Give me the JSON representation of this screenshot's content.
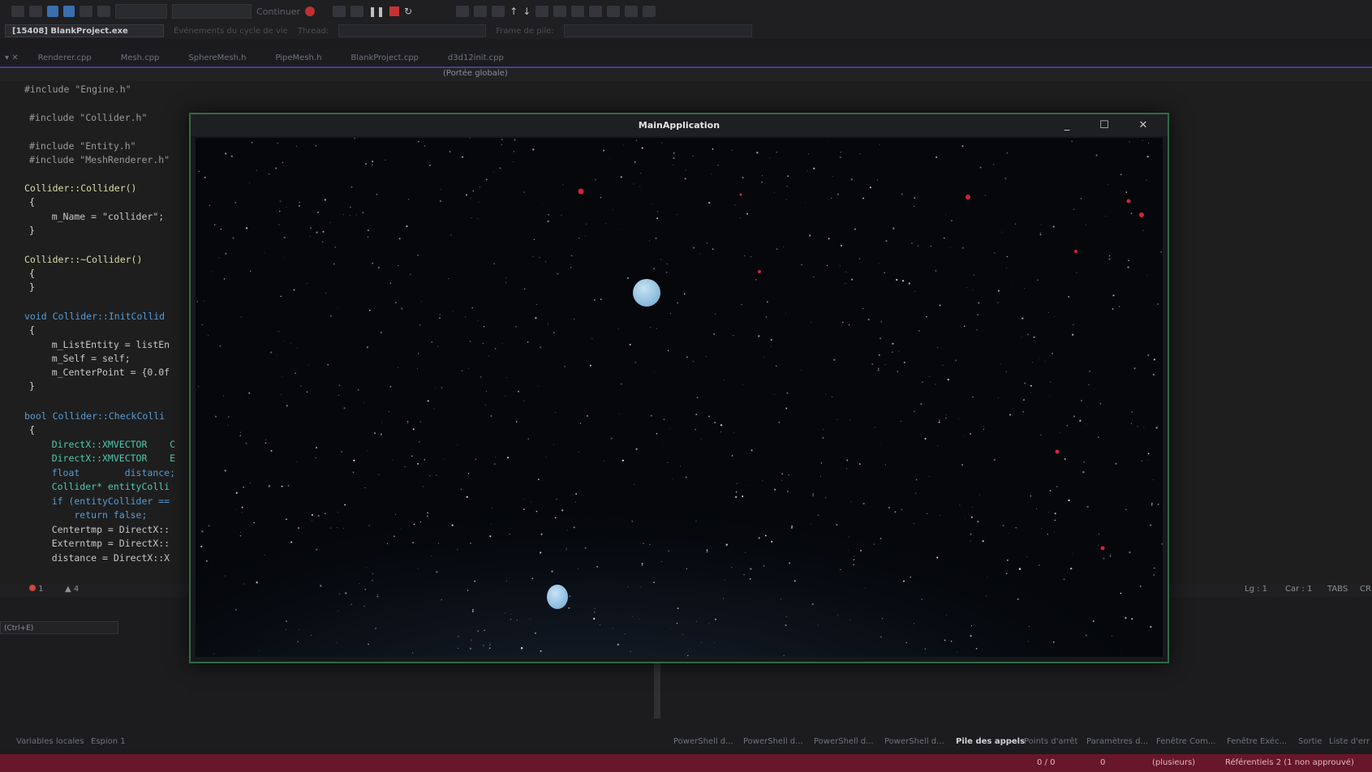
{
  "toolbar": {
    "continue_label": "Continuer",
    "process_label": "[15408] BlankProject.exe",
    "lifecycle_label": "Événements du cycle de vie",
    "thread_label": "Thread:",
    "stack_label": "Frame de pile:"
  },
  "tabs": [
    {
      "label": "Renderer.cpp"
    },
    {
      "label": "Mesh.cpp"
    },
    {
      "label": "SphereMesh.h"
    },
    {
      "label": "PipeMesh.h"
    },
    {
      "label": "BlankProject.cpp"
    },
    {
      "label": "d3d12init.cpp"
    }
  ],
  "navbar": {
    "scope": "(Portée globale)"
  },
  "code": {
    "l01": "#include \"Engine.h\"",
    "l02": "#include \"Collider.h\"",
    "l03": "#include \"Entity.h\"",
    "l04": "#include \"MeshRenderer.h\"",
    "l05": "Collider::Collider()",
    "l06": "{",
    "l07": "    m_Name = \"collider\";",
    "l08": "}",
    "l09": "Collider::~Collider()",
    "l10": "{",
    "l11": "}",
    "l12": "void Collider::InitCollid",
    "l13": "{",
    "l14": "    m_ListEntity = listEn",
    "l15": "    m_Self = self;",
    "l16": "    m_CenterPoint = {0.0f",
    "l17": "}",
    "l18": "bool Collider::CheckColli",
    "l19": "{",
    "l20": "    DirectX::XMVECTOR    C",
    "l21": "    DirectX::XMVECTOR    E",
    "l22": "    float        distance;",
    "l23": "    Collider* entityColli",
    "l24": "    if (entityCollider ==",
    "l25": "        return false;",
    "l26": "    Centertmp = DirectX::",
    "l27": "    Externtmp = DirectX::",
    "l28": "    distance = DirectX::X"
  },
  "editor_status": {
    "errors": "1",
    "warnings": "4",
    "line": "Lg : 1",
    "col": "Car : 1",
    "tabs": "TABS",
    "eol": "CR"
  },
  "lower_panel": {
    "search_placeholder": "(Ctrl+E)"
  },
  "bottom_tabs": {
    "left1": "Variables locales",
    "left2": "Espion 1",
    "t1": "PowerShell d...",
    "t2": "PowerShell d...",
    "t3": "PowerShell d...",
    "t4": "PowerShell d...",
    "t5": "Pile des appels",
    "t6": "Points d'arrêt",
    "t7": "Paramètres d...",
    "t8": "Fenêtre Com...",
    "t9": "Fenêtre Exéc...",
    "t10": "Sortie",
    "t11": "Liste d'err"
  },
  "status_bar": {
    "pos": "0 / 0",
    "edits": "0",
    "branch": "(plusieurs)",
    "repos": "Référentiels 2 (1 non approuvé)"
  },
  "app_window": {
    "title": "MainApplication",
    "minimize": "_",
    "maximize": "☐",
    "close": "✕"
  },
  "colors": {
    "statusbar": "#681629",
    "accent_tab": "#4a3f8a",
    "window_border": "#2f6a45",
    "planet": "#9fc8e6",
    "red_star": "#d2233b"
  }
}
